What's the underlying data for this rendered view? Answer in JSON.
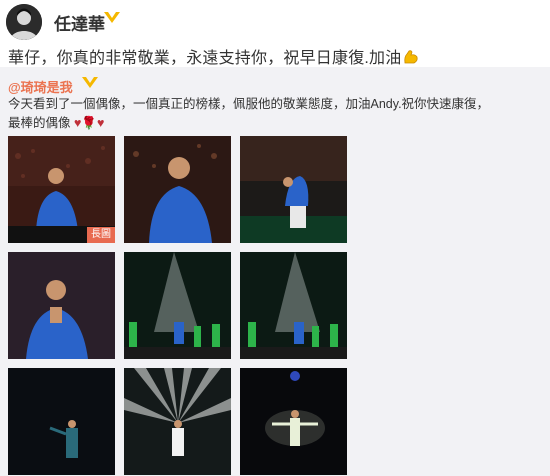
{
  "post": {
    "author": "任達華",
    "text": "華仔，你真的非常敬業，永遠支持你，祝早日康復.加油"
  },
  "repost": {
    "author": "@琦琦是我",
    "text_line1": "今天看到了一個偶像，一個真正的榜樣，佩服他的敬業態度，加油Andy.祝你快速康復，",
    "text_line2": "最棒的偶像 ",
    "emoji_text": "♥🌹♥",
    "images": [
      {
        "badge": "長圖"
      },
      {},
      {},
      {},
      {},
      {},
      {},
      {},
      {}
    ]
  },
  "colors": {
    "repost_author": "#eb7350",
    "verified_badge": "#f5b800",
    "performer_blue": "#2a63c9",
    "badge_bg": "#e86a50"
  },
  "icons": [
    "verified-icon",
    "flexed-biceps-icon"
  ]
}
